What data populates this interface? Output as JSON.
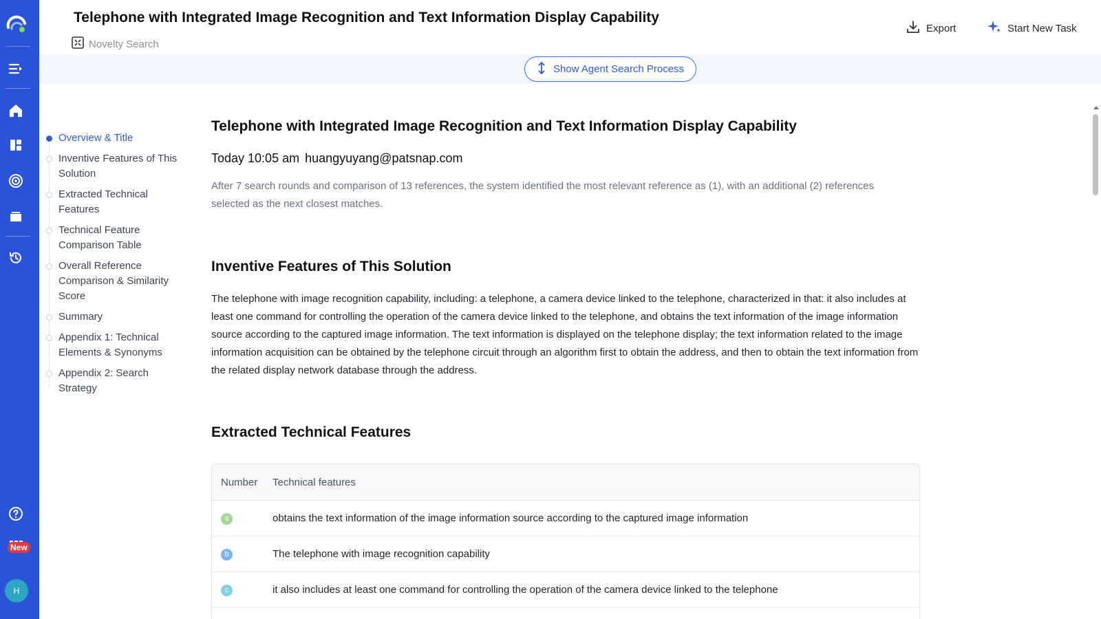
{
  "header": {
    "title": "Telephone with Integrated Image Recognition and Text Information Display Capability",
    "subtitle": "Novelty Search",
    "export_label": "Export",
    "new_task_label": "Start New Task"
  },
  "sidebar_rail": {
    "icons": [
      "logo-icon",
      "menu-expand-icon",
      "home-icon",
      "dashboard-icon",
      "radar-icon",
      "folder-icon",
      "history-icon",
      "help-icon",
      "apps-grid-icon"
    ],
    "new_badge": "New",
    "avatar_initial": "H",
    "accent": "#2b53d9"
  },
  "agent_bar": {
    "button_label": "Show Agent Search Process"
  },
  "toc": {
    "items": [
      {
        "label": "Overview & Title",
        "active": true
      },
      {
        "label": "Inventive Features of This Solution"
      },
      {
        "label": "Extracted Technical Features"
      },
      {
        "label": "Technical Feature Comparison Table"
      },
      {
        "label": "Overall Reference Comparison & Similarity Score"
      },
      {
        "label": "Summary"
      },
      {
        "label": "Appendix 1: Technical Elements & Synonyms"
      },
      {
        "label": "Appendix 2: Search Strategy"
      }
    ]
  },
  "main": {
    "doc_title": "Telephone with Integrated Image Recognition and Text Information Display Capability",
    "meta_time": "Today 10:05 am",
    "meta_user": "huangyuyang@patsnap.com",
    "summary": "After 7 search rounds and comparison of 13 references, the system identified the most relevant reference as (1), with an additional (2) references selected as the next closest matches.",
    "section1_title": "Inventive Features of This Solution",
    "section1_text": "The telephone with image recognition capability, including: a telephone, a camera device linked to the telephone, characterized in that: it also includes at least one command for controlling the operation of the camera device linked to the telephone, and obtains the text information of the image information source according to the captured image information. The text information is displayed on the telephone display; the text information related to the image information acquisition can be obtained by the telephone circuit through an algorithm first to obtain the address, and then to obtain the text information from the related display network database through the address.",
    "section2_title": "Extracted Technical Features",
    "table": {
      "headers": {
        "number": "Number",
        "feature": "Technical features"
      },
      "rows": [
        {
          "letter": "a",
          "color": "#a6d59a",
          "feature": "obtains the text information of the image information source according to the captured image information"
        },
        {
          "letter": "b",
          "color": "#7fb3f0",
          "feature": "The telephone with image recognition capability"
        },
        {
          "letter": "c",
          "color": "#7fd3e0",
          "feature": "it also includes at least one command for controlling the operation of the camera device linked to the telephone"
        }
      ]
    }
  }
}
